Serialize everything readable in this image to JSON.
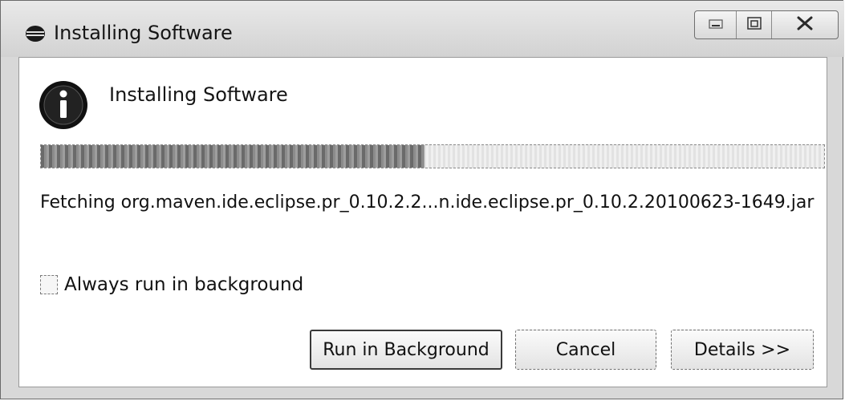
{
  "window": {
    "title": "Installing Software",
    "icon": "eclipse-icon",
    "controls": {
      "minimize_icon": "minimize-icon",
      "restore_icon": "restore-icon",
      "close_icon": "close-icon"
    }
  },
  "dialog": {
    "header_icon": "info-icon",
    "header": "Installing Software",
    "progress_fraction": 0.49,
    "status": "Fetching org.maven.ide.eclipse.pr_0.10.2.2...n.ide.eclipse.pr_0.10.2.20100623-1649.jar",
    "checkbox": {
      "label": "Always run in background",
      "checked": false
    },
    "buttons": {
      "run_in_background": "Run in Background",
      "cancel": "Cancel",
      "details": "Details >>"
    }
  }
}
